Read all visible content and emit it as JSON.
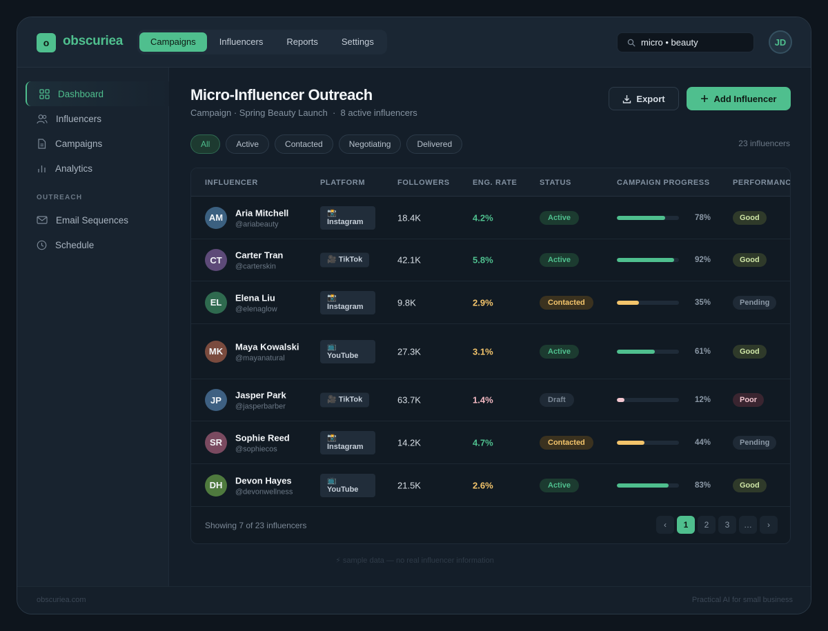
{
  "brand": {
    "logo_letter": "o",
    "name": "obscuriea"
  },
  "topnav": [
    "Campaigns",
    "Influencers",
    "Reports",
    "Settings"
  ],
  "search": {
    "value": "micro • beauty"
  },
  "user": {
    "initials": "JD"
  },
  "sidebar": {
    "items": [
      "Dashboard",
      "Influencers",
      "Campaigns",
      "Analytics"
    ],
    "section_heading": "OUTREACH",
    "outreach_items": [
      "Email Sequences",
      "Schedule"
    ]
  },
  "page": {
    "title": "Micro-Influencer Outreach",
    "subtitle": "Campaign · Spring Beauty Launch  ·  8 active influencers",
    "export_label": "Export",
    "add_label": "Add Influencer"
  },
  "filters": [
    "All",
    "Active",
    "Contacted",
    "Negotiating",
    "Delivered"
  ],
  "total_count": "23 influencers",
  "table": {
    "headers": [
      "INFLUENCER",
      "PLATFORM",
      "FOLLOWERS",
      "ENG. RATE",
      "STATUS",
      "CAMPAIGN PROGRESS",
      "PERFORMANCE"
    ],
    "rows": [
      {
        "initials": "AM",
        "name": "Aria Mitchell",
        "handle": "@ariabeauty",
        "platform": "📸 Instagram",
        "followers": "18.4K",
        "eng": "4.2%",
        "status": "Active",
        "progress": "78%",
        "perf": "Good"
      },
      {
        "initials": "CT",
        "name": "Carter Tran",
        "handle": "@carterskin",
        "platform": "🎥 TikTok",
        "followers": "42.1K",
        "eng": "5.8%",
        "status": "Active",
        "progress": "92%",
        "perf": "Good"
      },
      {
        "initials": "EL",
        "name": "Elena Liu",
        "handle": "@elenaglow",
        "platform": "📸 Instagram",
        "followers": "9.8K",
        "eng": "2.9%",
        "status": "Contacted",
        "progress": "35%",
        "perf": "Pending"
      },
      {
        "initials": "MK",
        "name": "Maya Kowalski",
        "handle": "@mayanatural",
        "platform": "📺 YouTube",
        "followers": "27.3K",
        "eng": "3.1%",
        "status": "Active",
        "progress": "61%",
        "perf": "Good"
      },
      {
        "initials": "JP",
        "name": "Jasper Park",
        "handle": "@jasperbarber",
        "platform": "🎥 TikTok",
        "followers": "63.7K",
        "eng": "1.4%",
        "status": "Draft",
        "progress": "12%",
        "perf": "Poor"
      },
      {
        "initials": "SR",
        "name": "Sophie Reed",
        "handle": "@sophiecos",
        "platform": "📸 Instagram",
        "followers": "14.2K",
        "eng": "4.7%",
        "status": "Contacted",
        "progress": "44%",
        "perf": "Pending"
      },
      {
        "initials": "DH",
        "name": "Devon Hayes",
        "handle": "@devonwellness",
        "platform": "📺 YouTube",
        "followers": "21.5K",
        "eng": "2.6%",
        "status": "Active",
        "progress": "83%",
        "perf": "Good"
      }
    ],
    "showing": "Showing 7 of 23 influencers",
    "pager": [
      "‹",
      "1",
      "2",
      "3",
      "…",
      "›"
    ]
  },
  "note": "⚡ sample data — no real influencer information",
  "footer": {
    "left": "obscuriea.com",
    "right": "Practical AI for small business"
  },
  "colors": {
    "accent": "#4fbf8e",
    "warn": "#f3c46b",
    "bad": "#f2b8c1"
  }
}
